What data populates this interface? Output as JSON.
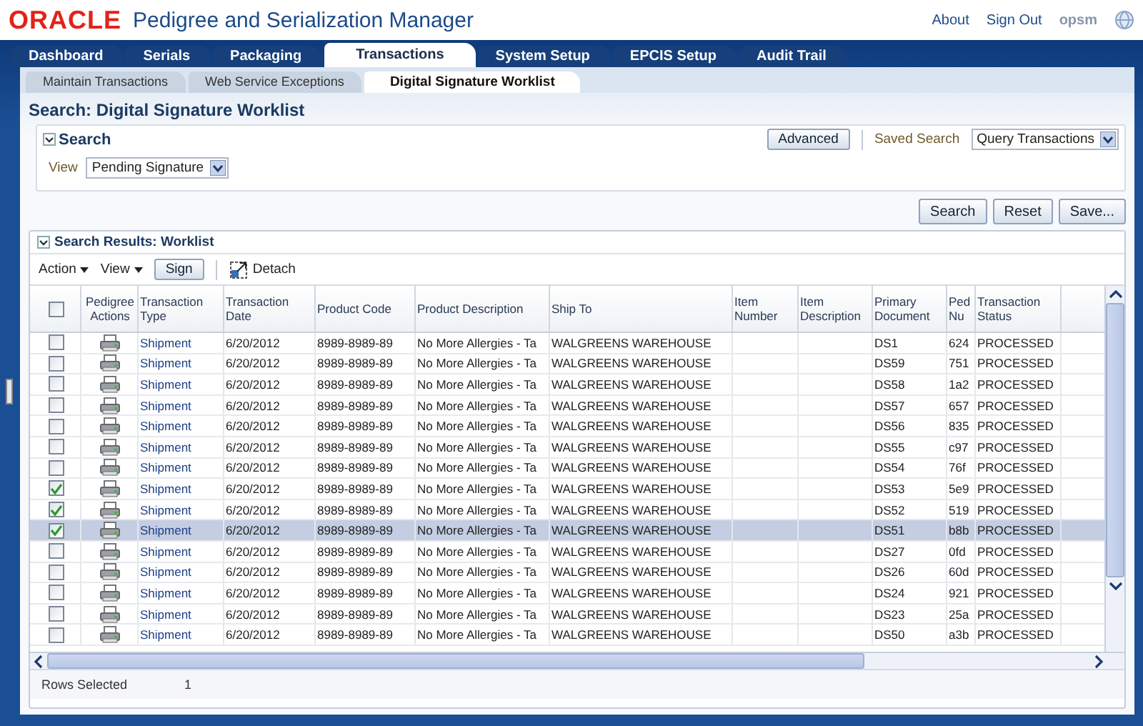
{
  "header": {
    "logo": "ORACLE",
    "app_title": "Pedigree and Serialization Manager",
    "links": [
      "About",
      "Sign Out"
    ],
    "user": "opsm"
  },
  "main_tabs": [
    {
      "label": "Dashboard",
      "selected": false
    },
    {
      "label": "Serials",
      "selected": false
    },
    {
      "label": "Packaging",
      "selected": false
    },
    {
      "label": "Transactions",
      "selected": true
    },
    {
      "label": "System Setup",
      "selected": false
    },
    {
      "label": "EPCIS Setup",
      "selected": false
    },
    {
      "label": "Audit Trail",
      "selected": false
    }
  ],
  "sub_tabs": [
    {
      "label": "Maintain Transactions",
      "selected": false
    },
    {
      "label": "Web Service Exceptions",
      "selected": false
    },
    {
      "label": "Digital Signature Worklist",
      "selected": true
    }
  ],
  "page_title": "Search: Digital Signature Worklist",
  "search": {
    "title": "Search",
    "expanded": true,
    "advanced_button": "Advanced",
    "saved_search_label": "Saved Search",
    "saved_search_value": "Query Transactions",
    "view_label": "View",
    "view_value": "Pending Signature",
    "buttons": [
      "Search",
      "Reset",
      "Save..."
    ]
  },
  "results": {
    "title": "Search Results: Worklist",
    "expanded": true,
    "select_all": {
      "checked": false
    },
    "menus": [
      "Action",
      "View"
    ],
    "sign_button": "Sign",
    "detach_button": "Detach",
    "columns": [
      "Pedigree Actions",
      "Transaction Type",
      "Transaction Date",
      "Product Code",
      "Product Description",
      "Ship To",
      "Item Number",
      "Item Description",
      "Primary Document",
      "Ped Nu",
      "Transaction Status"
    ],
    "rows": [
      {
        "checked": false,
        "selected": false,
        "type": "Shipment",
        "date": "6/20/2012",
        "code": "8989-8989-89",
        "description": "No More Allergies - Ta",
        "ship_to": "WALGREENS WAREHOUSE",
        "document": "DS1",
        "ped": "624",
        "status": "PROCESSED"
      },
      {
        "checked": false,
        "selected": false,
        "type": "Shipment",
        "date": "6/20/2012",
        "code": "8989-8989-89",
        "description": "No More Allergies - Ta",
        "ship_to": "WALGREENS WAREHOUSE",
        "document": "DS59",
        "ped": "751",
        "status": "PROCESSED"
      },
      {
        "checked": false,
        "selected": false,
        "type": "Shipment",
        "date": "6/20/2012",
        "code": "8989-8989-89",
        "description": "No More Allergies - Ta",
        "ship_to": "WALGREENS WAREHOUSE",
        "document": "DS58",
        "ped": "1a2",
        "status": "PROCESSED"
      },
      {
        "checked": false,
        "selected": false,
        "type": "Shipment",
        "date": "6/20/2012",
        "code": "8989-8989-89",
        "description": "No More Allergies - Ta",
        "ship_to": "WALGREENS WAREHOUSE",
        "document": "DS57",
        "ped": "657",
        "status": "PROCESSED"
      },
      {
        "checked": false,
        "selected": false,
        "type": "Shipment",
        "date": "6/20/2012",
        "code": "8989-8989-89",
        "description": "No More Allergies - Ta",
        "ship_to": "WALGREENS WAREHOUSE",
        "document": "DS56",
        "ped": "835",
        "status": "PROCESSED"
      },
      {
        "checked": false,
        "selected": false,
        "type": "Shipment",
        "date": "6/20/2012",
        "code": "8989-8989-89",
        "description": "No More Allergies - Ta",
        "ship_to": "WALGREENS WAREHOUSE",
        "document": "DS55",
        "ped": "c97",
        "status": "PROCESSED"
      },
      {
        "checked": false,
        "selected": false,
        "type": "Shipment",
        "date": "6/20/2012",
        "code": "8989-8989-89",
        "description": "No More Allergies - Ta",
        "ship_to": "WALGREENS WAREHOUSE",
        "document": "DS54",
        "ped": "76f",
        "status": "PROCESSED"
      },
      {
        "checked": true,
        "selected": false,
        "type": "Shipment",
        "date": "6/20/2012",
        "code": "8989-8989-89",
        "description": "No More Allergies - Ta",
        "ship_to": "WALGREENS WAREHOUSE",
        "document": "DS53",
        "ped": "5e9",
        "status": "PROCESSED"
      },
      {
        "checked": true,
        "selected": false,
        "type": "Shipment",
        "date": "6/20/2012",
        "code": "8989-8989-89",
        "description": "No More Allergies - Ta",
        "ship_to": "WALGREENS WAREHOUSE",
        "document": "DS52",
        "ped": "519",
        "status": "PROCESSED"
      },
      {
        "checked": true,
        "selected": true,
        "type": "Shipment",
        "date": "6/20/2012",
        "code": "8989-8989-89",
        "description": "No More Allergies - Ta",
        "ship_to": "WALGREENS WAREHOUSE",
        "document": "DS51",
        "ped": "b8b",
        "status": "PROCESSED"
      },
      {
        "checked": false,
        "selected": false,
        "type": "Shipment",
        "date": "6/20/2012",
        "code": "8989-8989-89",
        "description": "No More Allergies - Ta",
        "ship_to": "WALGREENS WAREHOUSE",
        "document": "DS27",
        "ped": "0fd",
        "status": "PROCESSED"
      },
      {
        "checked": false,
        "selected": false,
        "type": "Shipment",
        "date": "6/20/2012",
        "code": "8989-8989-89",
        "description": "No More Allergies - Ta",
        "ship_to": "WALGREENS WAREHOUSE",
        "document": "DS26",
        "ped": "60d",
        "status": "PROCESSED"
      },
      {
        "checked": false,
        "selected": false,
        "type": "Shipment",
        "date": "6/20/2012",
        "code": "8989-8989-89",
        "description": "No More Allergies - Ta",
        "ship_to": "WALGREENS WAREHOUSE",
        "document": "DS24",
        "ped": "921",
        "status": "PROCESSED"
      },
      {
        "checked": false,
        "selected": false,
        "type": "Shipment",
        "date": "6/20/2012",
        "code": "8989-8989-89",
        "description": "No More Allergies - Ta",
        "ship_to": "WALGREENS WAREHOUSE",
        "document": "DS23",
        "ped": "25a",
        "status": "PROCESSED"
      },
      {
        "checked": false,
        "selected": false,
        "type": "Shipment",
        "date": "6/20/2012",
        "code": "8989-8989-89",
        "description": "No More Allergies - Ta",
        "ship_to": "WALGREENS WAREHOUSE",
        "document": "DS50",
        "ped": "a3b",
        "status": "PROCESSED"
      }
    ],
    "footer": {
      "label": "Rows Selected",
      "value": "1"
    }
  }
}
